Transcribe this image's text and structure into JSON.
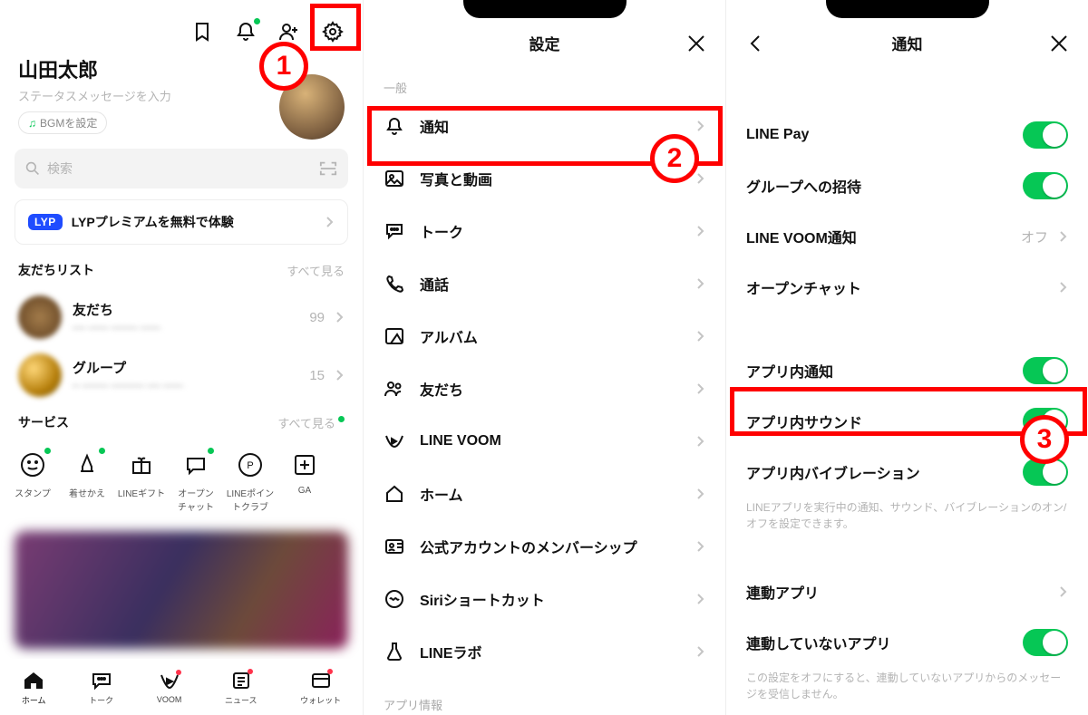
{
  "annotations": {
    "n1": "1",
    "n2": "2",
    "n3": "3"
  },
  "screen1": {
    "profile_name": "山田太郎",
    "status_placeholder": "ステータスメッセージを入力",
    "bgm_label": "BGMを設定",
    "search_placeholder": "検索",
    "lyp_badge": "LYP",
    "lyp_text": "LYPプレミアムを無料で体験",
    "friends_section_title": "友だちリスト",
    "see_all": "すべて見る",
    "friends": [
      {
        "name": "友だち",
        "count": "99"
      },
      {
        "name": "グループ",
        "count": "15"
      }
    ],
    "services_section_title": "サービス",
    "services": [
      {
        "name": "スタンプ"
      },
      {
        "name": "着せかえ"
      },
      {
        "name": "LINEギフト"
      },
      {
        "name": "オープン\nチャット"
      },
      {
        "name": "LINEポイン\nトクラブ"
      },
      {
        "name": "GA"
      }
    ],
    "tabs": [
      {
        "name": "ホーム"
      },
      {
        "name": "トーク"
      },
      {
        "name": "VOOM"
      },
      {
        "name": "ニュース"
      },
      {
        "name": "ウォレット"
      }
    ]
  },
  "screen2": {
    "title": "設定",
    "section_general": "一般",
    "items": [
      {
        "label": "通知"
      },
      {
        "label": "写真と動画"
      },
      {
        "label": "トーク"
      },
      {
        "label": "通話"
      },
      {
        "label": "アルバム"
      },
      {
        "label": "友だち"
      },
      {
        "label": "LINE VOOM"
      },
      {
        "label": "ホーム"
      },
      {
        "label": "公式アカウントのメンバーシップ"
      },
      {
        "label": "Siriショートカット"
      },
      {
        "label": "LINEラボ"
      }
    ],
    "section_app": "アプリ情報"
  },
  "screen3": {
    "title": "通知",
    "items_top": [
      {
        "label": "LINE Pay",
        "toggle": true
      },
      {
        "label": "グループへの招待",
        "toggle": true
      },
      {
        "label": "LINE VOOM通知",
        "value": "オフ"
      },
      {
        "label": "オープンチャット",
        "chev": true
      }
    ],
    "items_mid": [
      {
        "label": "アプリ内通知",
        "toggle": true
      },
      {
        "label": "アプリ内サウンド",
        "toggle": true
      },
      {
        "label": "アプリ内バイブレーション",
        "toggle": true
      }
    ],
    "desc1": "LINEアプリを実行中の通知、サウンド、バイブレーションのオン/オフを設定できます。",
    "items_bottom": [
      {
        "label": "連動アプリ",
        "chev": true
      },
      {
        "label": "連動していないアプリ",
        "toggle": true
      }
    ],
    "desc2": "この設定をオフにすると、連動していないアプリからのメッセージを受信しません。"
  }
}
